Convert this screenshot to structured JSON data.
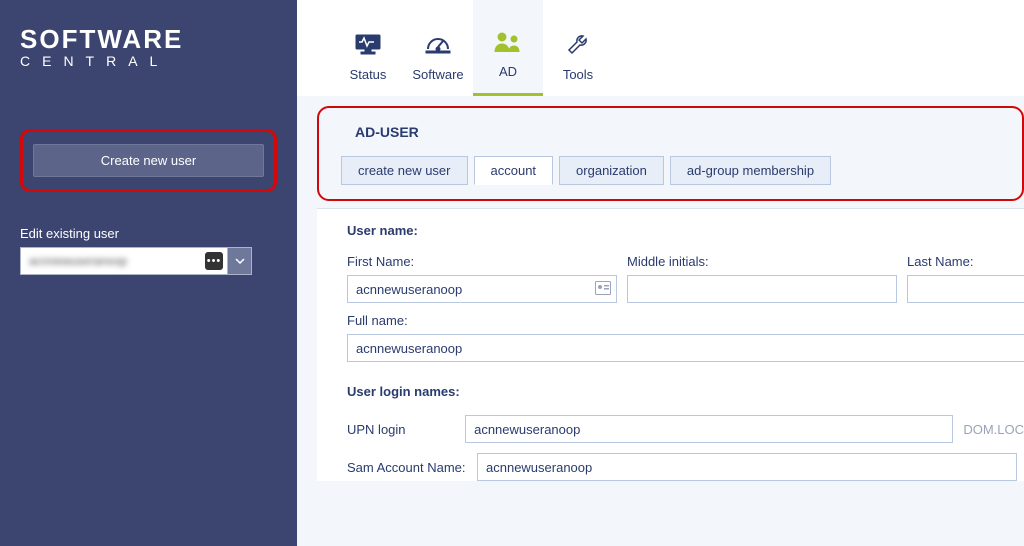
{
  "brand": {
    "line1": "SOFTWARE",
    "line2": "CENTRAL"
  },
  "sidebar": {
    "create_btn": "Create new user",
    "edit_label": "Edit existing user",
    "edit_value": "acnnewuseranoop"
  },
  "topnav": {
    "items": [
      {
        "label": "Status",
        "icon": "status-icon"
      },
      {
        "label": "Software",
        "icon": "software-icon"
      },
      {
        "label": "AD",
        "icon": "ad-icon",
        "active": true
      },
      {
        "label": "Tools",
        "icon": "tools-icon"
      }
    ]
  },
  "panel": {
    "title": "AD-USER",
    "tabs": [
      {
        "label": "create new user"
      },
      {
        "label": "account",
        "active": true
      },
      {
        "label": "organization"
      },
      {
        "label": "ad-group membership"
      }
    ]
  },
  "form": {
    "user_name_header": "User name:",
    "first_name_label": "First Name:",
    "first_name_value": "acnnewuseranoop",
    "middle_label": "Middle initials:",
    "middle_value": "",
    "last_name_label": "Last Name:",
    "last_name_value": "",
    "full_name_label": "Full name:",
    "full_name_value": "acnnewuseranoop",
    "login_header": "User login names:",
    "upn_label": "UPN login",
    "upn_value": "acnnewuseranoop",
    "upn_suffix": "DOM.LOC",
    "sam_label": "Sam Account Name:",
    "sam_value": "acnnewuseranoop"
  }
}
